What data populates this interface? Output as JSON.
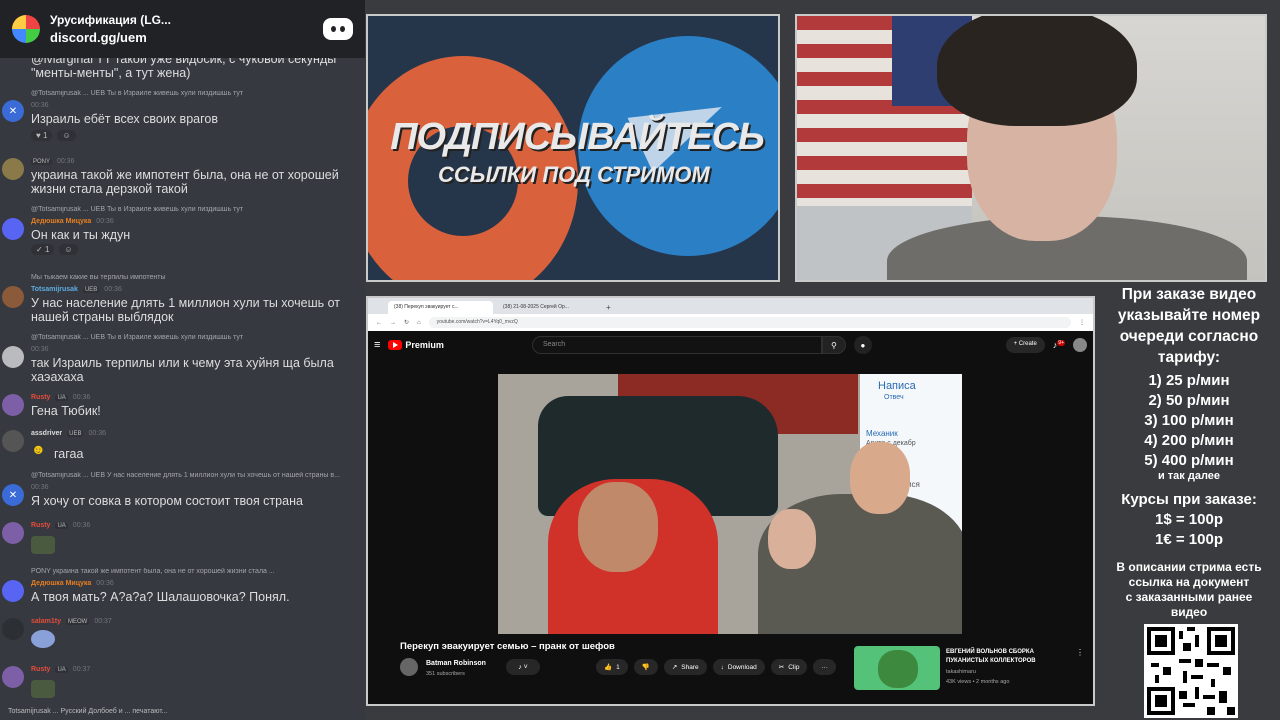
{
  "server": {
    "name": "Урусификация (LG...",
    "link": "discord.gg/uem"
  },
  "messages": [
    {
      "text": "@iviarginal TT такой уже видосик, с чуковой секунды \"менты-менты\", а тут жена)"
    },
    {
      "reply": "@Totsamijrusak ... UEB  Ты в Израиле живешь хули пиздишшь тут",
      "time": "00:36",
      "text": "Израиль ебёт всех своих врагов",
      "reactions": [
        "1"
      ]
    },
    {
      "badge": "PONY",
      "time": "00:36",
      "text": "украина такой же импотент была, она не от хорошей жизни стала дерзкой такой"
    },
    {
      "reply": "@Totsamijrusak ... UEB  Ты в Израиле живешь хули пиздишшь тут",
      "username": "Дедюшка Мицука",
      "time": "00:36",
      "text": "Он как и ты ждун",
      "reactions": [
        "1"
      ]
    },
    {
      "reply": "Мы тыкаем какие вы терпилы импотенты",
      "username": "Totsamijrusak",
      "badge": "UEB",
      "time": "00:36",
      "text": "У нас население длять 1 миллион хули ты хочешь от нашей страны выблядок"
    },
    {
      "reply": "@Totsamijrusak ... UEB  Ты в Израиле живешь хули пиздишшь тут",
      "time": "00:36",
      "text": "так Израиль терпилы или к чему эта хуйня ща была хаэахаха"
    },
    {
      "username": "Rusty",
      "badge": "UA",
      "time": "00:36",
      "text": "Гена Тюбик!"
    },
    {
      "username": "assdriver",
      "badge": "UEB",
      "time": "00:36",
      "text": "гагаа"
    },
    {
      "reply": "@Totsamijrusak ... UEB  У нас население длять 1 миллион хули ты хочешь от нашей страны в...",
      "time": "00:36",
      "text": "Я хочу от совка в котором состоит твоя страна"
    },
    {
      "username": "Rusty",
      "badge": "UA",
      "time": "00:36"
    },
    {
      "reply": "PONY  украина такой же импотент была, она не от хорошей жизни стала ...",
      "username": "Дедюшка Мицука",
      "time": "00:36",
      "text": "А твоя мать? А?а?а? Шалашовочка? Понял."
    },
    {
      "username": "salam1ty",
      "badge": "MEOW",
      "time": "00:37"
    },
    {
      "username": "Rusty",
      "badge": "UA",
      "time": "00:37"
    }
  ],
  "typing": "Totsamijrusak ... Русский Долбоеб и ... печатают...",
  "promo": {
    "title": "ПОДПИСЫВАЙТЕСЬ",
    "subtitle": "ССЫЛКИ ПОД СТРИМОМ"
  },
  "browser": {
    "tab1": "(38) Перекуп эвакуирует с...",
    "tab2": "(38) 21-08-2025 Сергей Ор...",
    "url": "youtube.com/watch?v=L4Yq0_mvzQ",
    "logo": "Premium",
    "search_placeholder": "Search",
    "create": "Create",
    "notif_count": "9+"
  },
  "video": {
    "title": "Перекуп эвакуирует семью – пранк от шефов",
    "channel": "Batman Robinson",
    "subs": "351 subscribers",
    "likes": "1",
    "share": "Share",
    "download": "Download",
    "clip": "Clip",
    "screen_t1": "Написа",
    "screen_t2": "Отвеч",
    "screen_t3": "Механик",
    "screen_t4": "Авито с декабр",
    "screen_t5": "Подпися"
  },
  "recommended": {
    "title": "ЕВГЕНИЙ ВОЛЬНОВ СБОРКА ПУКАНИСТЫХ КОЛЛЕКТОРОВ",
    "channel": "takashimaru",
    "views": "43K views • 2 months ago"
  },
  "pricing": {
    "header": [
      "При заказе видео",
      "указывайте номер",
      "очереди согласно",
      "тарифу:"
    ],
    "tiers": [
      "1) 25 р/мин",
      "2) 50 р/мин",
      "3) 100 р/мин",
      "4) 200 р/мин",
      "5) 400 р/мин"
    ],
    "more": "и так далее",
    "rates": [
      "Курсы при заказе:",
      "1$ = 100р",
      "1€ = 100р"
    ],
    "description": [
      "В описании стрима есть",
      "ссылка на документ",
      "с заказанными ранее",
      "видео"
    ]
  },
  "colors": {
    "discord_bg": "#36393f",
    "promo_bg": "#25354a",
    "youtube_bg": "#0f0f0f",
    "page_bg": "#3a3b3e"
  }
}
